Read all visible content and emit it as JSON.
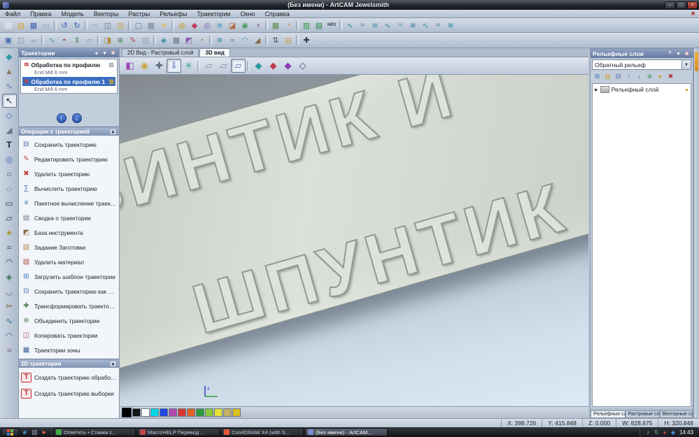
{
  "window": {
    "title": "(Без имени) - ArtCAM Jewelsmith",
    "minimize_glyph": "–",
    "maximize_glyph": "□",
    "close_glyph": "×"
  },
  "menubar": {
    "items": [
      "Файл",
      "Правка",
      "Модель",
      "Векторы",
      "Растры",
      "Рельефы",
      "Траектории",
      "Окно",
      "Справка"
    ],
    "mdi_close": "✖"
  },
  "toolbar_row1": {
    "icons": [
      {
        "name": "new-model-icon",
        "glyph": "▤",
        "color": "#f2f4f8"
      },
      {
        "name": "open-model-icon",
        "glyph": "▨",
        "color": "#d8a940"
      },
      {
        "name": "save-model-icon",
        "glyph": "▦",
        "color": "#3a5fae"
      },
      {
        "name": "print-icon",
        "glyph": "▭",
        "color": "#8d99a8"
      },
      {
        "sep": true
      },
      {
        "name": "undo-icon",
        "glyph": "↺",
        "color": "#2f5fae"
      },
      {
        "name": "redo-icon",
        "glyph": "↻",
        "color": "#2f5fae"
      },
      {
        "sep": true
      },
      {
        "name": "cut-icon",
        "glyph": "✂",
        "color": "#9aa6b4"
      },
      {
        "name": "copy-icon",
        "glyph": "◫",
        "color": "#6a7a92"
      },
      {
        "name": "paste-icon",
        "glyph": "▥",
        "color": "#c9a45a"
      },
      {
        "sep": true
      },
      {
        "name": "model-dimensions-icon",
        "glyph": "▢",
        "color": "#5a84b8"
      },
      {
        "name": "greyscale-view-icon",
        "glyph": "▩",
        "color": "#7e8a98"
      },
      {
        "name": "lighting-icon",
        "glyph": "☀",
        "color": "#e2b63a"
      },
      {
        "sep": true
      },
      {
        "name": "ring-wizard-icon",
        "glyph": "◍",
        "color": "#c9a43a"
      },
      {
        "name": "gem-tool-icon",
        "glyph": "◆",
        "color": "#c23a5e"
      },
      {
        "name": "rotary-relief-icon",
        "glyph": "◎",
        "color": "#7a5ab2"
      },
      {
        "name": "two-rail-sweep-icon",
        "glyph": "≋",
        "color": "#3a8fb2"
      },
      {
        "name": "extrude-icon",
        "glyph": "◪",
        "color": "#b2673a"
      },
      {
        "name": "spin-icon",
        "glyph": "◉",
        "color": "#4a9a5e"
      },
      {
        "name": "turn-icon",
        "glyph": "◑",
        "color": "#8a6ab2"
      },
      {
        "sep": true
      },
      {
        "name": "texture-relief-icon",
        "glyph": "▦",
        "color": "#5a8a4a"
      },
      {
        "name": "face-wizard-icon",
        "glyph": "◔",
        "color": "#c98a4a"
      },
      {
        "sep": true
      },
      {
        "name": "pcb-wizard-icon",
        "glyph": "▥",
        "color": "#2f9a3f"
      },
      {
        "name": "pcb-relief-icon",
        "glyph": "▤",
        "color": "#22843a"
      },
      {
        "name": "nr3-tool-icon",
        "glyph": "NR3",
        "color": "#343c46",
        "text": true
      },
      {
        "sep": true
      },
      {
        "name": "sweep-profile-1-icon",
        "glyph": "∿",
        "color": "#2a8da0"
      },
      {
        "name": "sweep-profile-2-icon",
        "glyph": "≈",
        "color": "#3a7da0"
      },
      {
        "name": "sweep-profile-3-icon",
        "glyph": "≋",
        "color": "#2a8da0"
      },
      {
        "name": "sweep-profile-4-icon",
        "glyph": "∿",
        "color": "#3a7da0"
      },
      {
        "name": "sweep-profile-5-icon",
        "glyph": "≈",
        "color": "#2a8da0"
      },
      {
        "name": "sweep-profile-6-icon",
        "glyph": "≋",
        "color": "#3a7da0"
      },
      {
        "name": "sweep-profile-7-icon",
        "glyph": "∿",
        "color": "#2a8da0"
      },
      {
        "name": "sweep-profile-8-icon",
        "glyph": "≈",
        "color": "#3a7da0"
      },
      {
        "name": "sweep-profile-9-icon",
        "glyph": "≋",
        "color": "#2a8da0"
      }
    ]
  },
  "toolbar_row2": {
    "icons": [
      {
        "name": "adjust-model-icon",
        "glyph": "▣",
        "color": "#4a6ab0"
      },
      {
        "name": "mirror-model-icon",
        "glyph": "◫",
        "color": "#7a8aa0"
      },
      {
        "name": "offset-model-icon",
        "glyph": "⇔",
        "color": "#3a7ac0"
      },
      {
        "sep": true
      },
      {
        "name": "smooth-relief-icon",
        "glyph": "∿",
        "color": "#4a8ab0"
      },
      {
        "name": "invert-relief-icon",
        "glyph": "◓",
        "color": "#b05a4a"
      },
      {
        "name": "scale-relief-icon",
        "glyph": "⇕",
        "color": "#4a8a5a"
      },
      {
        "name": "reset-relief-icon",
        "glyph": "▱",
        "color": "#8a96a6"
      },
      {
        "sep": true
      },
      {
        "name": "copy-relief-icon",
        "glyph": "◨",
        "color": "#b08a3a"
      },
      {
        "name": "merge-relief-icon",
        "glyph": "⊕",
        "color": "#4a8a5a"
      },
      {
        "name": "sculpt-icon",
        "glyph": "✎",
        "color": "#b04a4a"
      },
      {
        "name": "erase-relief-icon",
        "glyph": "▨",
        "color": "#9aa6b4"
      },
      {
        "sep": true
      },
      {
        "name": "vector-trace-icon",
        "glyph": "◈",
        "color": "#3a8aa0"
      },
      {
        "name": "bitmap-layer-icon",
        "glyph": "▩",
        "color": "#6a7a8e"
      },
      {
        "name": "emboss-wizard-icon",
        "glyph": "◩",
        "color": "#8a5ab0"
      },
      {
        "name": "dome-tool-icon",
        "glyph": "◔",
        "color": "#b07a3a"
      },
      {
        "sep": true
      },
      {
        "name": "weave-wizard-icon",
        "glyph": "≋",
        "color": "#2a8da0"
      },
      {
        "name": "texture-flow-icon",
        "glyph": "≈",
        "color": "#3a7da0"
      },
      {
        "name": "isoform-icon",
        "glyph": "◠",
        "color": "#4a8ab0"
      },
      {
        "name": "extrude-relief-icon",
        "glyph": "◢",
        "color": "#8a6a4a"
      },
      {
        "sep": true
      },
      {
        "name": "measure-icon",
        "glyph": "⇅",
        "color": "#47506a"
      },
      {
        "name": "notes-icon",
        "glyph": "▤",
        "color": "#c9a45a"
      },
      {
        "sep": true
      },
      {
        "name": "move-model-icon",
        "glyph": "✚",
        "color": "#2f3844"
      }
    ]
  },
  "left_toolbar": {
    "icons": [
      {
        "name": "gem-select-icon",
        "glyph": "◆",
        "color": "#2f9aa6"
      },
      {
        "name": "relief-node-icon",
        "glyph": "▲",
        "color": "#8a7a56"
      },
      {
        "name": "smooth-brush-icon",
        "glyph": "∿",
        "color": "#5a7ab0"
      },
      {
        "name": "select-vectors-icon",
        "glyph": "↖",
        "color": "#14181e",
        "pressed": true
      },
      {
        "name": "node-editing-icon",
        "glyph": "◇",
        "color": "#3a66b0"
      },
      {
        "name": "measure-tool-icon",
        "glyph": "◢",
        "color": "#6a7686"
      },
      {
        "name": "create-text-icon",
        "glyph": "T",
        "color": "#1c222a",
        "text": true
      },
      {
        "name": "zoom-tool-icon",
        "glyph": "◎",
        "color": "#3a66b0"
      },
      {
        "name": "create-circle-icon",
        "glyph": "○",
        "color": "#39424e"
      },
      {
        "name": "create-ellipse-icon",
        "glyph": "◌",
        "color": "#39424e"
      },
      {
        "name": "create-rectangle-icon",
        "glyph": "▭",
        "color": "#39424e"
      },
      {
        "name": "create-polygon-icon",
        "glyph": "▱",
        "color": "#39424e"
      },
      {
        "name": "create-star-icon",
        "glyph": "★",
        "color": "#b0983a"
      },
      {
        "name": "create-polyline-icon",
        "glyph": "≈",
        "color": "#39424e"
      },
      {
        "name": "create-arc-icon",
        "glyph": "◠",
        "color": "#39424e"
      },
      {
        "name": "offset-vector-icon",
        "glyph": "◈",
        "color": "#3a7a56"
      },
      {
        "name": "fillet-tool-icon",
        "glyph": "◡",
        "color": "#704a90"
      },
      {
        "name": "trim-vectors-icon",
        "glyph": "✂",
        "color": "#806a50"
      },
      {
        "name": "join-vectors-icon",
        "glyph": "∿",
        "color": "#2f6a9a"
      },
      {
        "name": "wrap-text-icon",
        "glyph": "◠",
        "color": "#2f6a9a"
      },
      {
        "name": "paste-along-curve-icon",
        "glyph": "≈",
        "color": "#704a90"
      }
    ]
  },
  "toolpath_panel": {
    "title": "Траектории",
    "header_icons": [
      {
        "name": "panel-scroll-icon",
        "glyph": "◂",
        "color": "#ffffff"
      },
      {
        "name": "panel-pin-icon",
        "glyph": "▾",
        "color": "#ffffff"
      },
      {
        "name": "panel-close-icon",
        "glyph": "✖",
        "color": "#ffd6d0"
      }
    ],
    "toolpaths": [
      {
        "label": "Обработка по профилю",
        "tool": "End Mill 6 mm",
        "icon_glyph": "≋",
        "icon_color": "#c04040",
        "badge_glyph": "▥",
        "badge_color": "#9aa6b4"
      },
      {
        "label": "Обработка по профилю 1",
        "tool": "End Mill 6 mm",
        "icon_glyph": "≋",
        "icon_color": "#c04040",
        "badge_glyph": "▥",
        "badge_color": "#c9a43a",
        "selected": true
      }
    ],
    "updown_icons": [
      {
        "name": "move-toolpath-up-button",
        "glyph": "↑",
        "color": "#ffffff"
      },
      {
        "name": "move-toolpath-down-button",
        "glyph": "↓",
        "color": "#ffffff"
      }
    ],
    "operations_header": "Операции с траекторией",
    "section_icons": [
      {
        "name": "collapse-section-icon",
        "glyph": "▴",
        "color": "#28324a"
      }
    ],
    "operations": [
      {
        "name": "save-toolpath-icon",
        "glyph": "⊟",
        "color": "#3a5fae",
        "label": "Сохранить траекторию"
      },
      {
        "name": "edit-toolpath-icon",
        "glyph": "✎",
        "color": "#c04848",
        "label": "Редактировать траекторию"
      },
      {
        "name": "delete-toolpath-icon",
        "glyph": "✖",
        "color": "#c03838",
        "label": "Удалить траекторию"
      },
      {
        "name": "calculate-toolpath-icon",
        "glyph": "∑",
        "color": "#3a7ab8",
        "label": "Вычислить траекторию"
      },
      {
        "name": "batch-calculate-icon",
        "glyph": "≡",
        "color": "#3a7ab8",
        "label": "Пакетное вычисление траекторий"
      },
      {
        "name": "toolpath-summary-icon",
        "glyph": "▤",
        "color": "#6a7a8e",
        "label": "Сводка о траектории"
      },
      {
        "name": "tool-database-icon",
        "glyph": "◩",
        "color": "#8a6a4a",
        "label": "База инструмента"
      },
      {
        "name": "material-setup-icon",
        "glyph": "▧",
        "color": "#b08848",
        "label": "Задание Заготовки"
      },
      {
        "name": "delete-material-icon",
        "glyph": "▨",
        "color": "#b05048",
        "label": "Удалить материал"
      },
      {
        "name": "load-toolpath-template-icon",
        "glyph": "⊞",
        "color": "#4a7ac0",
        "label": "Загрузить шаблон траектории"
      },
      {
        "name": "save-toolpath-template-icon",
        "glyph": "⊟",
        "color": "#4a7ac0",
        "label": "Сохранить траекторию как шаблон"
      },
      {
        "name": "transform-toolpath-icon",
        "glyph": "✚",
        "color": "#508050",
        "label": "Трансформировать траектории"
      },
      {
        "name": "merge-toolpaths-icon",
        "glyph": "⊕",
        "color": "#508050",
        "label": "Объединить траектории"
      },
      {
        "name": "copy-toolpath-icon",
        "glyph": "◫",
        "color": "#b04868",
        "label": "Копировать траектории"
      },
      {
        "name": "toolpath-zones-icon",
        "glyph": "▦",
        "color": "#4060a0",
        "label": "Траектории зоны"
      }
    ],
    "toolpaths2d_header": "2D траектории",
    "section_icons2": [
      {
        "name": "collapse-section-icon",
        "glyph": "▴",
        "color": "#28324a"
      }
    ],
    "toolpaths2d": [
      {
        "name": "profile-toolpath-icon",
        "glyph": "T",
        "color": "#c03030",
        "label": "Создать траекторию обработки по профилю"
      },
      {
        "name": "area-clearance-toolpath-icon",
        "glyph": "T",
        "color": "#c03030",
        "label": "Создать траекторию выборки"
      }
    ]
  },
  "canvas": {
    "tabs": [
      {
        "label": "2D Вид - Растровый слой"
      },
      {
        "label": "3D вид",
        "active": true
      }
    ],
    "view_toolbar": [
      {
        "name": "view-cube-icon",
        "glyph": "◧",
        "color": "#9a4ab0"
      },
      {
        "name": "zoom-objects-icon",
        "glyph": "◉",
        "color": "#c9a43a"
      },
      {
        "name": "pan-view-icon",
        "glyph": "✚",
        "color": "#5a6a80"
      },
      {
        "name": "toggle-z-icon",
        "glyph": "⇩",
        "color": "#3a5ac0",
        "pressed": true
      },
      {
        "name": "twirl-view-icon",
        "glyph": "✳",
        "color": "#3aa08e"
      },
      {
        "sep": true
      },
      {
        "name": "draw-plane-x-icon",
        "glyph": "▱",
        "color": "#8a96a6"
      },
      {
        "name": "draw-plane-y-icon",
        "glyph": "▱",
        "color": "#7a86a6"
      },
      {
        "name": "draw-plane-z-icon",
        "glyph": "▱",
        "color": "#6a76a6",
        "pressed": true
      },
      {
        "sep": true
      },
      {
        "name": "relief-preview-icon",
        "glyph": "◆",
        "color": "#2a9aa0"
      },
      {
        "name": "relief-delete-icon",
        "glyph": "◆",
        "color": "#c03a4a"
      },
      {
        "name": "relief-invert-icon",
        "glyph": "◆",
        "color": "#8a3ab0"
      },
      {
        "name": "relief-wireframe-icon",
        "glyph": "◇",
        "color": "#47507a"
      }
    ],
    "relief": {
      "line1": "ВИНТИК И",
      "line2": "ШПУНТИК"
    },
    "palette": [
      "#000000",
      "#141414",
      "#ffffff",
      "#00d8e8",
      "#2248e0",
      "#b048b0",
      "#d83838",
      "#e06028",
      "#2f9a3f",
      "#8cc83a",
      "#e8e030",
      "#c0b060",
      "#d8c020"
    ]
  },
  "relief_panel": {
    "title": "Рельефные слои",
    "header_icons": [
      {
        "name": "panel-help-icon",
        "glyph": "?",
        "color": "#ffffff",
        "text": true
      },
      {
        "name": "panel-pin-icon",
        "glyph": "▾",
        "color": "#ffffff"
      },
      {
        "name": "panel-close-icon",
        "glyph": "✖",
        "color": "#ffd6d0"
      }
    ],
    "combo_value": "Обратный рельеф",
    "combo_arrow": "▼",
    "tool_icons": [
      {
        "name": "new-layer-icon",
        "glyph": "⊞",
        "color": "#4a7ac0"
      },
      {
        "name": "open-layer-icon",
        "glyph": "▨",
        "color": "#c9a43a"
      },
      {
        "name": "save-layer-icon",
        "glyph": "⊟",
        "color": "#3a5fae"
      },
      {
        "name": "layer-up-icon",
        "glyph": "↑",
        "color": "#3a66b0"
      },
      {
        "name": "layer-down-icon",
        "glyph": "↓",
        "color": "#3a66b0"
      },
      {
        "name": "merge-layers-icon",
        "glyph": "⊕",
        "color": "#4a8a5a"
      },
      {
        "name": "toggle-visibility-icon",
        "glyph": "●",
        "color": "#c9a43a"
      },
      {
        "name": "delete-layer-icon",
        "glyph": "✖",
        "color": "#b03a3a"
      }
    ],
    "layers": [
      {
        "name_label": "Рельефный слой",
        "expander": "▶",
        "bulb": "●",
        "bulb_color": "#c9a43a"
      }
    ],
    "tabs": [
      {
        "label": "Рельефные сл...",
        "active": true
      },
      {
        "label": "Растровые слои"
      },
      {
        "label": "Векторные сл..."
      }
    ]
  },
  "statusbar": {
    "coords": [
      "X: 398.726",
      "Y: 415.848",
      "Z: 0.000",
      "W: 828.675",
      "H: 320.848"
    ]
  },
  "taskbar": {
    "quick_launch": [
      {
        "name": "quick-launch-browser-icon",
        "glyph": "e",
        "color": "#4ab0e8",
        "text": true
      },
      {
        "name": "quick-launch-desktop-icon",
        "glyph": "▤",
        "color": "#9aa6b4"
      },
      {
        "name": "quick-launch-player-icon",
        "glyph": "►",
        "color": "#e06838"
      }
    ],
    "windows": [
      {
        "icon_name": "task-icon-forum",
        "icon_color": "#4aa84a",
        "label": "Ответить • Станки с..."
      },
      {
        "icon_name": "task-icon-help",
        "icon_color": "#c04848",
        "label": "МастсHELP Перевод ..."
      },
      {
        "icon_name": "task-icon-coreldraw",
        "icon_color": "#e05a3a",
        "label": "CorelDRAW X4 (with S..."
      },
      {
        "icon_name": "task-icon-artcam",
        "icon_color": "#7a8ac8",
        "label": "(Без имени) - ArtCAM...",
        "active": true
      }
    ],
    "tray_icons": [
      {
        "name": "tray-volume-icon",
        "glyph": "♪",
        "color": "#cfd6de"
      },
      {
        "name": "tray-network-icon",
        "glyph": "⇅",
        "color": "#5ab05a"
      },
      {
        "name": "tray-antivirus-icon",
        "glyph": "●",
        "color": "#c04848"
      },
      {
        "name": "tray-update-icon",
        "glyph": "◆",
        "color": "#4a8ac8"
      }
    ],
    "time": "14:43"
  }
}
